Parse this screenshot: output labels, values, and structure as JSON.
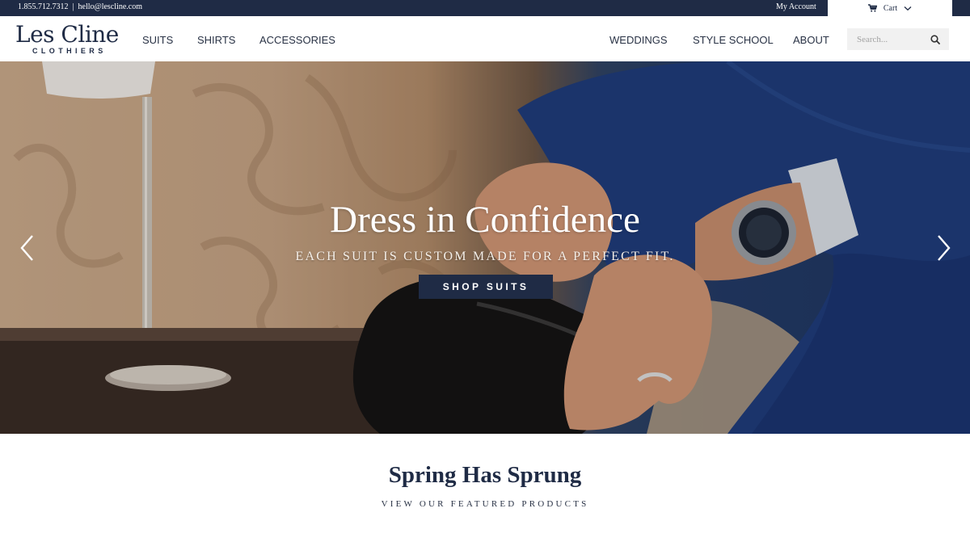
{
  "topbar": {
    "phone": "1.855.712.7312",
    "separator": "|",
    "email": "hello@lescline.com",
    "account_label": "My Account",
    "cart_label": "Cart",
    "cart_icon": "shopping-cart-icon",
    "dropdown_icon": "chevron-down-icon",
    "background_color": "#1f2b45"
  },
  "header": {
    "logo": {
      "name": "Les Cline",
      "tagline": "CLOTHIERS"
    },
    "nav_left": [
      "SUITS",
      "SHIRTS",
      "ACCESSORIES"
    ],
    "nav_right": [
      "WEDDINGS",
      "STYLE SCHOOL",
      "ABOUT"
    ],
    "search": {
      "placeholder": "Search...",
      "icon": "search-icon"
    }
  },
  "hero": {
    "title": "Dress in Confidence",
    "subtitle": "EACH SUIT IS CUSTOM MADE FOR A PERFECT FIT.",
    "cta_label": "SHOP SUITS",
    "prev_icon": "chevron-left-icon",
    "next_icon": "chevron-right-icon",
    "accent_color": "#1f2b45"
  },
  "featured": {
    "title": "Spring Has Sprung",
    "subtitle": "VIEW OUR FEATURED PRODUCTS"
  }
}
